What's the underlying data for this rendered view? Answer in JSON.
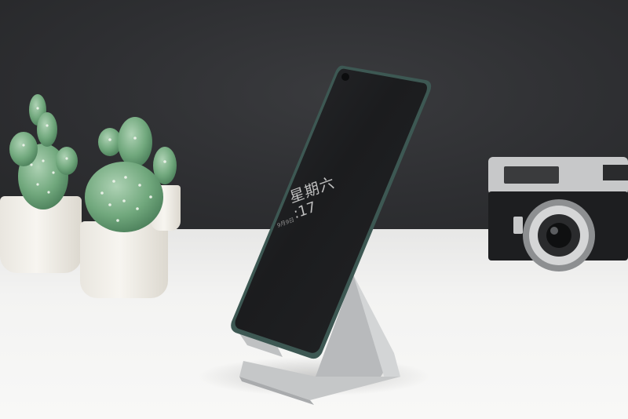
{
  "phone_screen": {
    "weekday": "星期六",
    "time": ":17",
    "subtext": "9月9日"
  },
  "colors": {
    "wall": "#2e2f32",
    "desk": "#f4f4f3",
    "cactus": "#6da47a",
    "stand": "#c9cbcc",
    "phone_screen": "#1e1f21"
  }
}
